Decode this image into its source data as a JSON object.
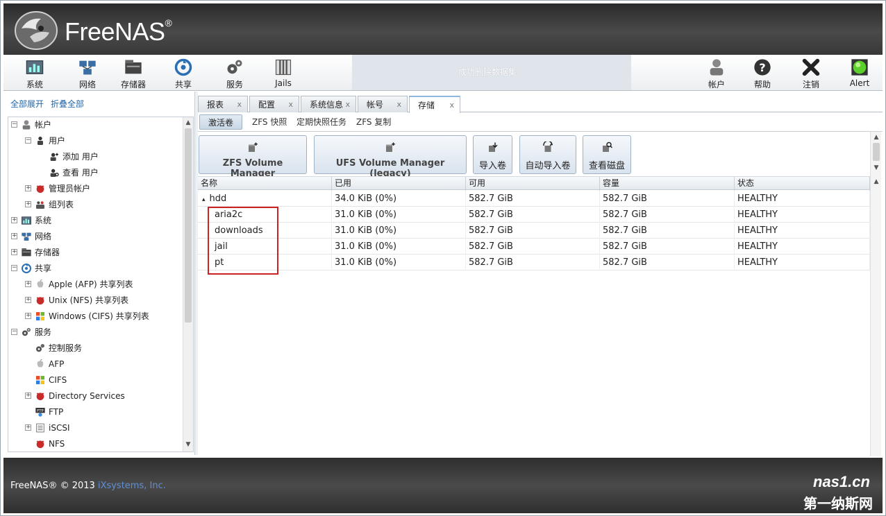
{
  "header": {
    "logo_text": "FreeNAS",
    "logo_reg": "®"
  },
  "toolbar": {
    "left": [
      {
        "label": "系统",
        "icon": "system-icon"
      },
      {
        "label": "网络",
        "icon": "network-icon"
      },
      {
        "label": "存储器",
        "icon": "storage-icon"
      },
      {
        "label": "共享",
        "icon": "sharing-icon"
      },
      {
        "label": "服务",
        "icon": "services-icon"
      },
      {
        "label": "Jails",
        "icon": "jails-icon"
      }
    ],
    "message": "成功删除数据集。",
    "right": [
      {
        "label": "帐户",
        "icon": "account-icon"
      },
      {
        "label": "帮助",
        "icon": "help-icon"
      },
      {
        "label": "注销",
        "icon": "logout-icon"
      },
      {
        "label": "Alert",
        "icon": "alert-icon"
      }
    ]
  },
  "tree_actions": {
    "expand_all": "全部展开",
    "collapse_all": "折叠全部"
  },
  "tree": [
    {
      "label": "帐户",
      "level": 0,
      "toggle": "−",
      "icon": "account-icon"
    },
    {
      "label": "用户",
      "level": 1,
      "toggle": "−",
      "icon": "user-icon"
    },
    {
      "label": "添加 用户",
      "level": 2,
      "toggle": "",
      "icon": "add-user-icon"
    },
    {
      "label": "查看 用户",
      "level": 2,
      "toggle": "",
      "icon": "view-user-icon"
    },
    {
      "label": "管理员帐户",
      "level": 1,
      "toggle": "+",
      "icon": "admin-icon"
    },
    {
      "label": "组列表",
      "level": 1,
      "toggle": "+",
      "icon": "group-icon"
    },
    {
      "label": "系统",
      "level": 0,
      "toggle": "+",
      "icon": "system-icon"
    },
    {
      "label": "网络",
      "level": 0,
      "toggle": "+",
      "icon": "network-icon"
    },
    {
      "label": "存储器",
      "level": 0,
      "toggle": "+",
      "icon": "storage-icon"
    },
    {
      "label": "共享",
      "level": 0,
      "toggle": "−",
      "icon": "sharing-icon"
    },
    {
      "label": "Apple (AFP) 共享列表",
      "level": 1,
      "toggle": "+",
      "icon": "apple-icon"
    },
    {
      "label": "Unix (NFS) 共享列表",
      "level": 1,
      "toggle": "+",
      "icon": "unix-icon"
    },
    {
      "label": "Windows (CIFS) 共享列表",
      "level": 1,
      "toggle": "+",
      "icon": "windows-icon"
    },
    {
      "label": "服务",
      "level": 0,
      "toggle": "−",
      "icon": "services-icon"
    },
    {
      "label": "控制服务",
      "level": 1,
      "toggle": "",
      "icon": "control-services-icon"
    },
    {
      "label": "AFP",
      "level": 1,
      "toggle": "",
      "icon": "apple-icon"
    },
    {
      "label": "CIFS",
      "level": 1,
      "toggle": "",
      "icon": "windows-icon"
    },
    {
      "label": "Directory Services",
      "level": 1,
      "toggle": "+",
      "icon": "unix-icon"
    },
    {
      "label": "FTP",
      "level": 1,
      "toggle": "",
      "icon": "ftp-icon"
    },
    {
      "label": "iSCSI",
      "level": 1,
      "toggle": "+",
      "icon": "iscsi-icon"
    },
    {
      "label": "NFS",
      "level": 1,
      "toggle": "",
      "icon": "unix-icon"
    }
  ],
  "tabs": [
    {
      "label": "报表",
      "close": "x"
    },
    {
      "label": "配置",
      "close": "x"
    },
    {
      "label": "系统信息",
      "close": "x"
    },
    {
      "label": "帐号",
      "close": "x"
    },
    {
      "label": "存储",
      "close": "x"
    }
  ],
  "subtabs": [
    "激活卷",
    "ZFS 快照",
    "定期快照任务",
    "ZFS 复制"
  ],
  "actions": [
    {
      "label": "ZFS Volume Manager",
      "icon": "volume-add-icon"
    },
    {
      "label": "UFS Volume Manager (legacy)",
      "icon": "volume-add-icon"
    },
    {
      "label": "导入卷",
      "icon": "import-icon"
    },
    {
      "label": "自动导入卷",
      "icon": "auto-import-icon"
    },
    {
      "label": "查看磁盘",
      "icon": "view-disks-icon"
    }
  ],
  "grid": {
    "columns": [
      "名称",
      "已用",
      "可用",
      "容量",
      "状态"
    ],
    "rows": [
      {
        "name": "hdd",
        "expander": "▴",
        "used": "34.0 KiB (0%)",
        "avail": "582.7 GiB",
        "size": "582.7 GiB",
        "status": "HEALTHY"
      },
      {
        "name": "aria2c",
        "expander": "",
        "used": "31.0 KiB (0%)",
        "avail": "582.7 GiB",
        "size": "582.7 GiB",
        "status": "HEALTHY"
      },
      {
        "name": "downloads",
        "expander": "",
        "used": "31.0 KiB (0%)",
        "avail": "582.7 GiB",
        "size": "582.7 GiB",
        "status": "HEALTHY"
      },
      {
        "name": "jail",
        "expander": "",
        "used": "31.0 KiB (0%)",
        "avail": "582.7 GiB",
        "size": "582.7 GiB",
        "status": "HEALTHY"
      },
      {
        "name": "pt",
        "expander": "",
        "used": "31.0 KiB (0%)",
        "avail": "582.7 GiB",
        "size": "582.7 GiB",
        "status": "HEALTHY"
      }
    ]
  },
  "footer": {
    "copyright": "FreeNAS® © 2013",
    "company": "iXsystems, Inc."
  },
  "watermark": {
    "top": "nas1.cn",
    "bottom": "第一纳斯网"
  },
  "colors": {
    "header_bg": "#3a3a3a",
    "link": "#2266aa",
    "highlight": "#cc2222"
  }
}
